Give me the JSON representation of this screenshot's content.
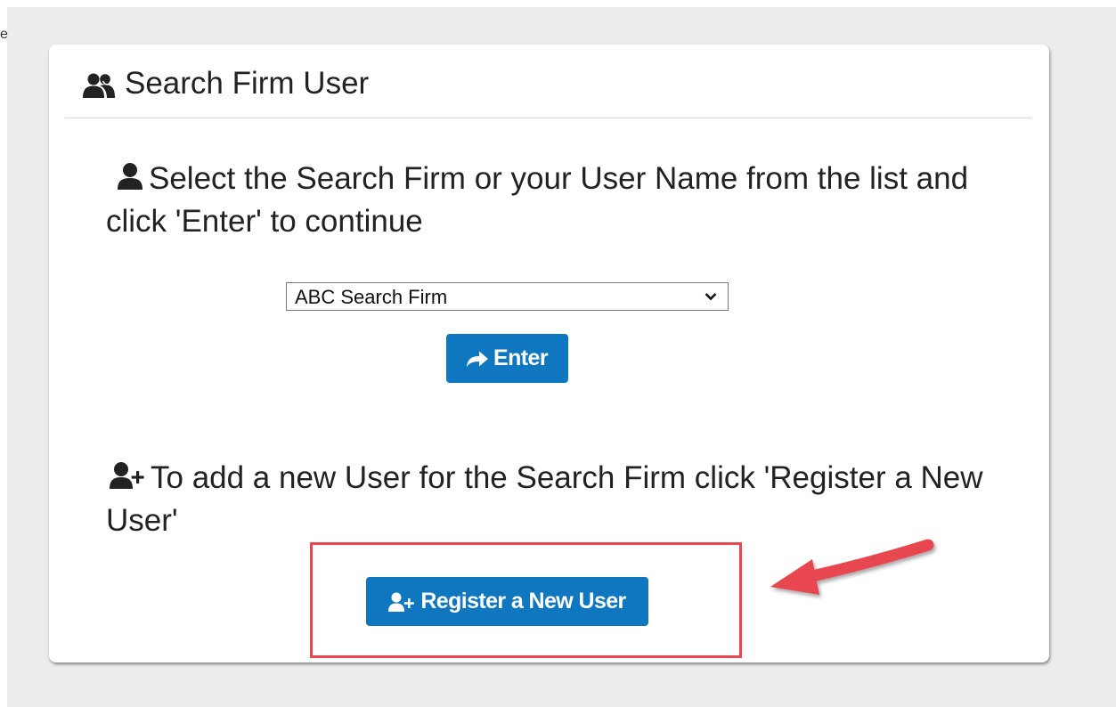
{
  "edge_glyph": "e",
  "panel": {
    "title": "Search Firm User",
    "title_icon": "users-icon"
  },
  "select_section": {
    "icon": "user-icon",
    "instruction": "Select the Search Firm or your User Name from the list and click 'Enter' to continue",
    "firm_select": {
      "selected_value": "ABC Search Firm",
      "arrow_icon": "chevron-down-icon"
    },
    "enter_button": {
      "label": "Enter",
      "icon": "share-arrow-icon"
    }
  },
  "register_section": {
    "icon": "user-plus-icon",
    "instruction": "To add a new User for the Search Firm click 'Register a New User'",
    "register_button": {
      "label": "Register a New User",
      "icon": "user-plus-icon"
    }
  },
  "annotation": {
    "highlight_color": "#e8474f",
    "arrow_color": "#e8474f"
  },
  "colors": {
    "button_primary": "#0e77bf",
    "background": "#ececec",
    "card": "#ffffff",
    "text": "#222222"
  }
}
